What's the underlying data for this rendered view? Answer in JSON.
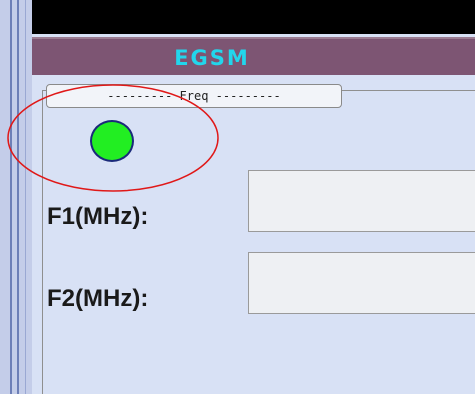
{
  "panel": {
    "title": "EGSM",
    "group_label": "--------- Freq ---------",
    "status_led": {
      "color": "#22ee22",
      "state": "on"
    }
  },
  "fields": [
    {
      "label": "F1(MHz):",
      "value": ""
    },
    {
      "label": "F2(MHz):",
      "value": ""
    }
  ],
  "annotation": {
    "shape": "ellipse",
    "color": "#e01818"
  }
}
